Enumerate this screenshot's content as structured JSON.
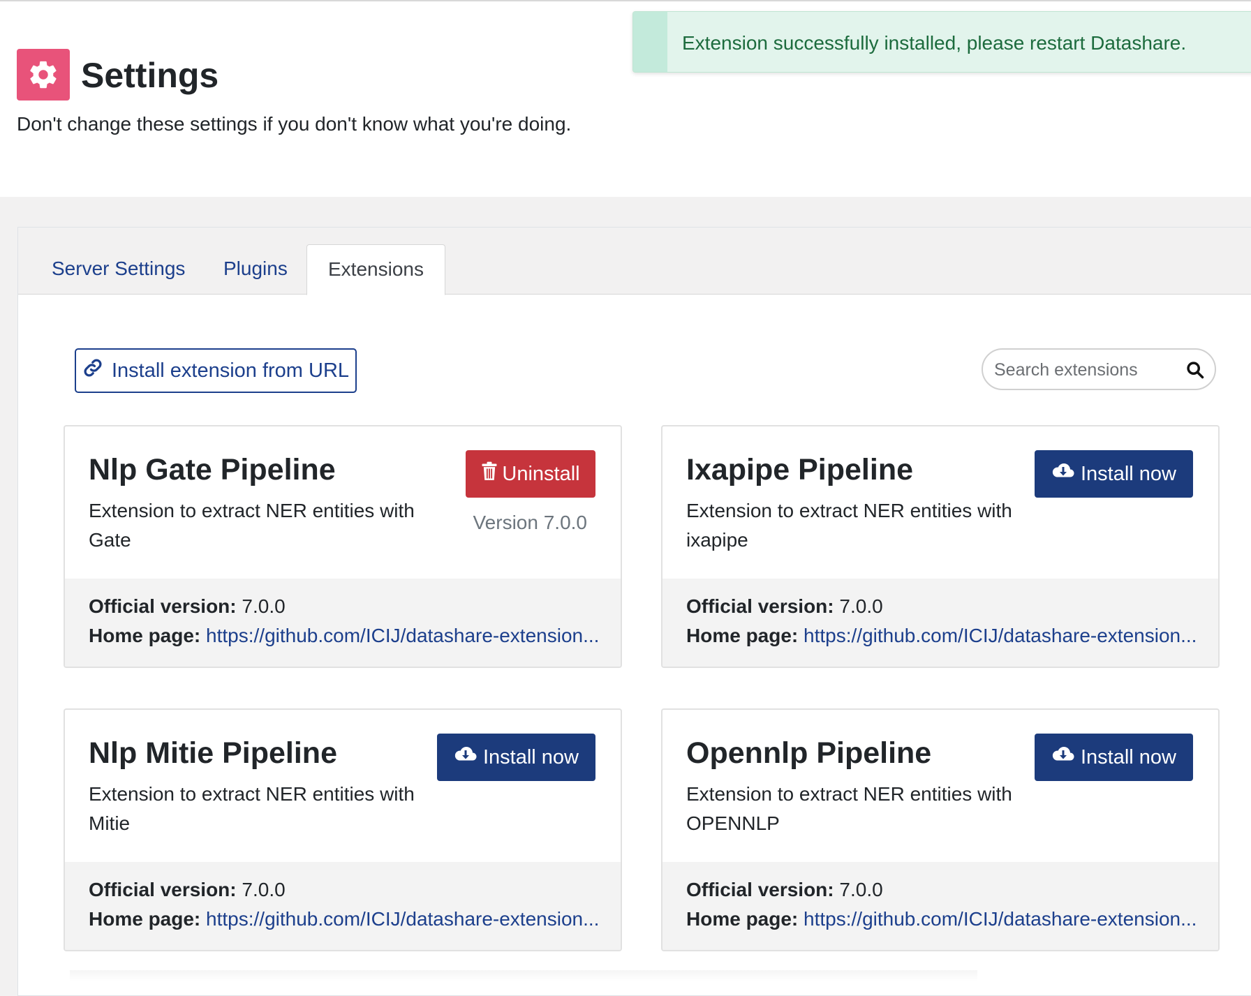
{
  "header": {
    "title": "Settings",
    "subtitle": "Don't change these settings if you don't know what you're doing."
  },
  "toast": {
    "message": "Extension successfully installed, please restart Datashare."
  },
  "tabs": [
    {
      "label": "Server Settings"
    },
    {
      "label": "Plugins"
    },
    {
      "label": "Extensions",
      "active": true
    }
  ],
  "toolbar": {
    "install_url_label": "Install extension from URL",
    "search_placeholder": "Search extensions"
  },
  "labels": {
    "official_version": "Official version:",
    "home_page": "Home page:"
  },
  "extensions": [
    {
      "name": "Nlp Gate Pipeline",
      "description": "Extension to extract NER entities with Gate",
      "action": "Uninstall",
      "installed_version": "Version 7.0.0",
      "official_version": "7.0.0",
      "home_page": "https://github.com/ICIJ/datashare-extension..."
    },
    {
      "name": "Ixapipe Pipeline",
      "description": "Extension to extract NER entities with ixapipe",
      "action": "Install now",
      "official_version": "7.0.0",
      "home_page": "https://github.com/ICIJ/datashare-extension..."
    },
    {
      "name": "Nlp Mitie Pipeline",
      "description": "Extension to extract NER entities with Mitie",
      "action": "Install now",
      "official_version": "7.0.0",
      "home_page": "https://github.com/ICIJ/datashare-extension..."
    },
    {
      "name": "Opennlp Pipeline",
      "description": "Extension to extract NER entities with OPENNLP",
      "action": "Install now",
      "official_version": "7.0.0",
      "home_page": "https://github.com/ICIJ/datashare-extension..."
    }
  ],
  "colors": {
    "primary": "#1c3b7c",
    "danger": "#c6343c",
    "brand_icon": "#e8537a",
    "success_bg": "#e2f4ec",
    "success_text": "#1c6b3d"
  }
}
